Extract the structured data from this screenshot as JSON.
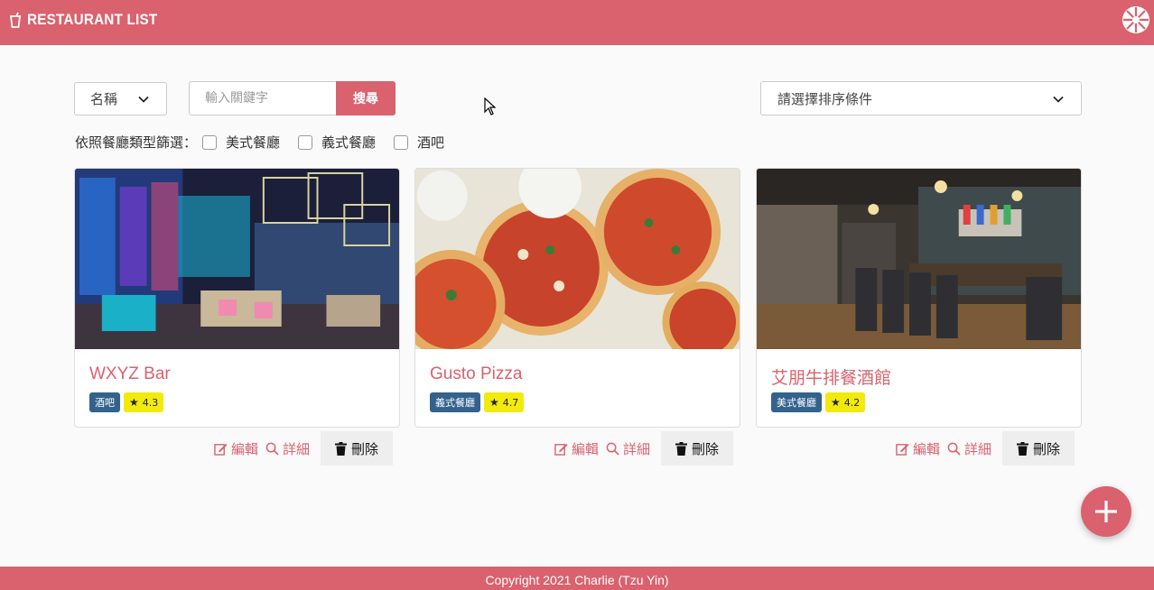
{
  "header": {
    "brand": "RESTAURANT LIST"
  },
  "search": {
    "field_select": "名稱",
    "placeholder": "輸入關鍵字",
    "button": "搜尋",
    "sort_placeholder": "請選擇排序條件"
  },
  "filter": {
    "label": "依照餐廳類型篩選：",
    "options": [
      "美式餐廳",
      "義式餐廳",
      "酒吧"
    ]
  },
  "restaurants": [
    {
      "name": "WXYZ Bar",
      "category": "酒吧",
      "rating": "4.3"
    },
    {
      "name": "Gusto Pizza",
      "category": "義式餐廳",
      "rating": "4.7"
    },
    {
      "name": "艾朋牛排餐酒館",
      "category": "美式餐廳",
      "rating": "4.2"
    }
  ],
  "actions": {
    "edit": "編輯",
    "detail": "詳細",
    "delete": "刪除"
  },
  "footer": {
    "copyright": "Copyright 2021 Charlie (Tzu Yin)"
  },
  "colors": {
    "primary": "#d9626e",
    "category_badge": "#33628d",
    "rating_badge": "#f2ea0c"
  }
}
